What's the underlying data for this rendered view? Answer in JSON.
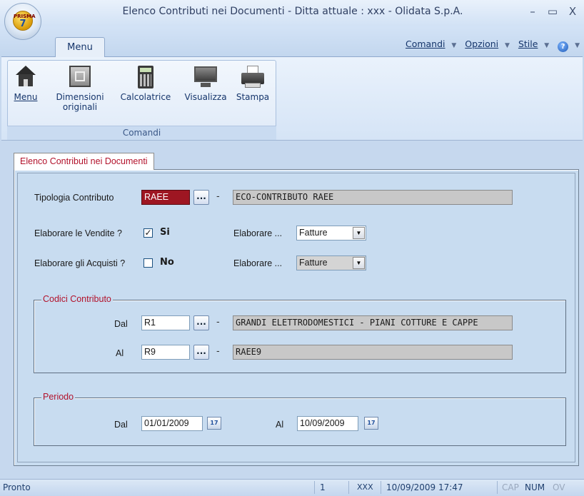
{
  "window": {
    "title": "Elenco Contributi nei Documenti - Ditta attuale : xxx - Olidata S.p.A.",
    "controls": {
      "minimize": "–",
      "maximize": "▭",
      "close": "X"
    },
    "logo_text": "PRISMA",
    "logo_number": "7"
  },
  "ribbon": {
    "tab": "Menu",
    "right_menu": {
      "comandi": "Comandi",
      "opzioni": "Opzioni",
      "stile": "Stile",
      "help": "?"
    },
    "group_label": "Comandi",
    "buttons": [
      {
        "label": "Menu",
        "icon": "home-icon"
      },
      {
        "label_line1": "Dimensioni",
        "label_line2": "originali",
        "icon": "original-size-icon"
      },
      {
        "label": "Calcolatrice",
        "icon": "calculator-icon"
      },
      {
        "label": "Visualizza",
        "icon": "monitor-icon"
      },
      {
        "label": "Stampa",
        "icon": "printer-icon"
      }
    ]
  },
  "content": {
    "tab_label": "Elenco Contributi nei Documenti",
    "tipologia": {
      "label": "Tipologia Contributo",
      "code": "RAEE",
      "description": "ECO-CONTRIBUTO RAEE"
    },
    "vendite": {
      "label": "Elaborare le Vendite ?",
      "checked": true,
      "value": "Si",
      "elab_label": "Elaborare ...",
      "elab_value": "Fatture"
    },
    "acquisti": {
      "label": "Elaborare gli Acquisti ?",
      "checked": false,
      "value": "No",
      "elab_label": "Elaborare ...",
      "elab_value": "Fatture"
    },
    "codici": {
      "legend": "Codici Contributo",
      "dal_label": "Dal",
      "dal_code": "R1",
      "dal_desc": "GRANDI ELETTRODOMESTICI - PIANI COTTURE E CAPPE",
      "al_label": "Al",
      "al_code": "R9",
      "al_desc": "RAEE9"
    },
    "periodo": {
      "legend": "Periodo",
      "dal_label": "Dal",
      "dal_date": "01/01/2009",
      "al_label": "Al",
      "al_date": "10/09/2009",
      "cal_text": "17"
    },
    "dots": "...",
    "dash": "-"
  },
  "status": {
    "text": "Pronto",
    "page": "1",
    "user": "XXX",
    "datetime": "10/09/2009 17:47",
    "cap": "CAP",
    "num": "NUM",
    "ov": "OV"
  }
}
